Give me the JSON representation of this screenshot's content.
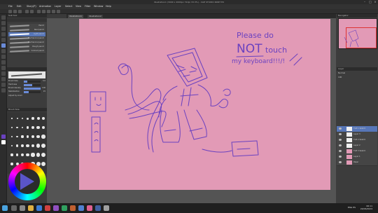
{
  "window": {
    "title": "Illustration1 (3000 x 2000px 72dpi 33.3%) - CLIP STUDIO PAINT EX"
  },
  "menu": [
    "File",
    "Edit",
    "Story(P)",
    "Animation",
    "Layer",
    "Select",
    "View",
    "Filter",
    "Window",
    "Help"
  ],
  "tabs": [
    "Illustration1",
    "Illustration2"
  ],
  "left_panel": {
    "tool_title": "Sub tool",
    "brushes": [
      "Pencil",
      "Real pencil",
      "Light pencil",
      "Mechanical pencil",
      "Mechanical pencil",
      "Rough pencil",
      "Colored pencil"
    ],
    "selected_brush": 2,
    "properties": [
      {
        "label": "Brush Size",
        "value": "3.0",
        "fill": 0.2
      },
      {
        "label": "Hardness",
        "value": "",
        "fill": 0.5
      },
      {
        "label": "Brush density",
        "value": "100",
        "fill": 1.0
      },
      {
        "label": "Stabilization",
        "value": "15",
        "fill": 0.3
      }
    ],
    "adjust_label": "Adjust by zoom",
    "size_title": "Brush Size"
  },
  "drawing_text": {
    "line1": "Please do",
    "line2": "NOT",
    "line3": "touch",
    "line4": "my keyboard!!!/!"
  },
  "right_panel": {
    "navigator_title": "Navigator",
    "layer_title": "Layer",
    "blend_mode": "Normal",
    "opacity": "100",
    "layers": [
      "TGE 1 Sketch",
      "Layer 3",
      "TGE 2 Sketch",
      "Layer 2",
      "TGE 3 Sketch",
      "Layer 1",
      "Paper"
    ],
    "selected_layer": 0
  },
  "taskbar": {
    "lang": "ENG",
    "region": "ES",
    "time": "06:11",
    "date": "24/06/2024"
  },
  "colors": {
    "paper": "#e29ab6",
    "stroke": "#6a41c0",
    "accent": "#5776b8"
  }
}
